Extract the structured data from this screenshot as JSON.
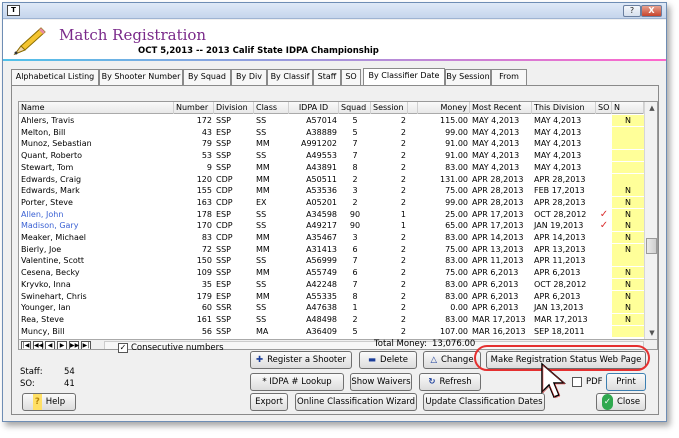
{
  "window": {
    "app_icon": "T",
    "help_btn": "?",
    "close_btn": "X"
  },
  "header": {
    "title": "Match Registration",
    "subtitle": "OCT  5,2013 -- 2013 Calif State IDPA Championship"
  },
  "tabs": [
    "Alphabetical Listing",
    "By Shooter Number",
    "By Squad",
    "By Div",
    "By Classif",
    "Staff",
    "SO",
    "By Classifier Date",
    "By Session",
    "From"
  ],
  "active_tab": 7,
  "columns": [
    "Name",
    "Number",
    "Division",
    "Class",
    "IDPA ID",
    "Squad",
    "Session",
    "",
    "Money",
    "Most Recent",
    "This Division",
    "SO",
    "N"
  ],
  "rows": [
    {
      "name": "Ahlers, Travis",
      "number": "172",
      "division": "SSP",
      "class": "SS",
      "idpa": "A57014",
      "squad": "5",
      "session": "2",
      "money": "115.00",
      "recent": "MAY  4,2013",
      "thisdiv": "MAY  4,2013",
      "so": "",
      "n": "N",
      "blue": false
    },
    {
      "name": "Melton, Bill",
      "number": "43",
      "division": "ESP",
      "class": "SS",
      "idpa": "A38889",
      "squad": "5",
      "session": "2",
      "money": "99.00",
      "recent": "MAY  4,2013",
      "thisdiv": "MAY  4,2013",
      "so": "",
      "n": "",
      "blue": false
    },
    {
      "name": "Munoz, Sebastian",
      "number": "79",
      "division": "SSP",
      "class": "MM",
      "idpa": "A991202",
      "squad": "7",
      "session": "2",
      "money": "91.00",
      "recent": "MAY  4,2013",
      "thisdiv": "MAY  4,2013",
      "so": "",
      "n": "",
      "blue": false
    },
    {
      "name": "Quant, Roberto",
      "number": "53",
      "division": "SSP",
      "class": "SS",
      "idpa": "A49553",
      "squad": "7",
      "session": "2",
      "money": "91.00",
      "recent": "MAY  4,2013",
      "thisdiv": "MAY  4,2013",
      "so": "",
      "n": "",
      "blue": false
    },
    {
      "name": "Stewart, Tom",
      "number": "9",
      "division": "SSP",
      "class": "MM",
      "idpa": "A43891",
      "squad": "8",
      "session": "2",
      "money": "83.00",
      "recent": "MAY  4,2013",
      "thisdiv": "MAY  4,2013",
      "so": "",
      "n": "",
      "blue": false
    },
    {
      "name": "Edwards, Craig",
      "number": "120",
      "division": "CDP",
      "class": "MM",
      "idpa": "A50511",
      "squad": "2",
      "session": "2",
      "money": "131.00",
      "recent": "APR 28,2013",
      "thisdiv": "APR 28,2013",
      "so": "",
      "n": "",
      "blue": false
    },
    {
      "name": "Edwards, Mark",
      "number": "155",
      "division": "CDP",
      "class": "MM",
      "idpa": "A53536",
      "squad": "3",
      "session": "2",
      "money": "75.00",
      "recent": "APR 28,2013",
      "thisdiv": "FEB 17,2013",
      "so": "",
      "n": "N",
      "blue": false
    },
    {
      "name": "Porter, Steve",
      "number": "163",
      "division": "CDP",
      "class": "EX",
      "idpa": "A05201",
      "squad": "2",
      "session": "2",
      "money": "99.00",
      "recent": "APR 28,2013",
      "thisdiv": "APR 28,2013",
      "so": "",
      "n": "N",
      "blue": false
    },
    {
      "name": "Allen, John",
      "number": "178",
      "division": "ESP",
      "class": "SS",
      "idpa": "A34598",
      "squad": "90",
      "session": "1",
      "money": "25.00",
      "recent": "APR 17,2013",
      "thisdiv": "OCT 28,2012",
      "so": "✓",
      "n": "N",
      "blue": true
    },
    {
      "name": "Madison, Gary",
      "number": "170",
      "division": "CDP",
      "class": "SS",
      "idpa": "A49217",
      "squad": "90",
      "session": "1",
      "money": "65.00",
      "recent": "APR 17,2013",
      "thisdiv": "JAN 19,2013",
      "so": "✓",
      "n": "N",
      "blue": true
    },
    {
      "name": "Meaker, Michael",
      "number": "83",
      "division": "CDP",
      "class": "MM",
      "idpa": "A35467",
      "squad": "3",
      "session": "2",
      "money": "83.00",
      "recent": "APR 14,2013",
      "thisdiv": "APR 14,2013",
      "so": "",
      "n": "N",
      "blue": false
    },
    {
      "name": "Bierly, Joe",
      "number": "72",
      "division": "SSP",
      "class": "MM",
      "idpa": "A31413",
      "squad": "6",
      "session": "2",
      "money": "75.00",
      "recent": "APR 13,2013",
      "thisdiv": "APR 13,2013",
      "so": "",
      "n": "N",
      "blue": false
    },
    {
      "name": "Valentine, Scott",
      "number": "150",
      "division": "SSP",
      "class": "SS",
      "idpa": "A56999",
      "squad": "7",
      "session": "2",
      "money": "83.00",
      "recent": "APR 11,2013",
      "thisdiv": "APR 11,2013",
      "so": "",
      "n": "",
      "blue": false
    },
    {
      "name": "Cesena, Becky",
      "number": "109",
      "division": "SSP",
      "class": "MM",
      "idpa": "A55749",
      "squad": "6",
      "session": "2",
      "money": "75.00",
      "recent": "APR  6,2013",
      "thisdiv": "APR  6,2013",
      "so": "",
      "n": "N",
      "blue": false
    },
    {
      "name": "Kryvko, Inna",
      "number": "35",
      "division": "ESP",
      "class": "SS",
      "idpa": "A42248",
      "squad": "7",
      "session": "2",
      "money": "83.00",
      "recent": "APR  6,2013",
      "thisdiv": "OCT 28,2012",
      "so": "",
      "n": "N",
      "blue": false
    },
    {
      "name": "Swinehart, Chris",
      "number": "179",
      "division": "ESP",
      "class": "MM",
      "idpa": "A55335",
      "squad": "8",
      "session": "2",
      "money": "83.00",
      "recent": "APR  6,2013",
      "thisdiv": "APR  6,2013",
      "so": "",
      "n": "N",
      "blue": false
    },
    {
      "name": "Younger, Ian",
      "number": "60",
      "division": "SSR",
      "class": "SS",
      "idpa": "A47638",
      "squad": "1",
      "session": "2",
      "money": "0.00",
      "recent": "APR  6,2013",
      "thisdiv": "JAN 13,2013",
      "so": "",
      "n": "N",
      "blue": false
    },
    {
      "name": "Rea, Steve",
      "number": "161",
      "division": "SSP",
      "class": "SS",
      "idpa": "A48498",
      "squad": "2",
      "session": "2",
      "money": "83.00",
      "recent": "MAR 17,2013",
      "thisdiv": "MAR 17,2013",
      "so": "",
      "n": "N",
      "blue": false
    },
    {
      "name": "Muncy, Bill",
      "number": "56",
      "division": "SSP",
      "class": "MA",
      "idpa": "A36409",
      "squad": "5",
      "session": "2",
      "money": "107.00",
      "recent": "MAR 16,2013",
      "thisdiv": "SEP 18,2011",
      "so": "",
      "n": "",
      "blue": false
    }
  ],
  "nav_buttons": [
    "|◀",
    "◀◀",
    "◀",
    "▶",
    "▶▶",
    "▶|"
  ],
  "footer": {
    "consecutive_label": "Consecutive numbers",
    "consecutive_checked": true,
    "total_money_label": "Total Money:",
    "total_money": "13,076.00",
    "staff_label": "Staff:",
    "staff_value": "54",
    "so_label": "SO:",
    "so_value": "41",
    "pdf_label": "PDF"
  },
  "buttons": {
    "register": "Register a Shooter",
    "delete": "Delete",
    "change": "Change",
    "web_page": "Make Registration Status Web Page",
    "idpa_lookup": "* IDPA # Lookup",
    "show_waivers": "Show Waivers",
    "refresh": "Refresh",
    "export": "Export",
    "online_wizard": "Online Classification Wizard",
    "update_dates": "Update Classification Dates",
    "help": "Help",
    "print": "Print",
    "close": "Close"
  }
}
